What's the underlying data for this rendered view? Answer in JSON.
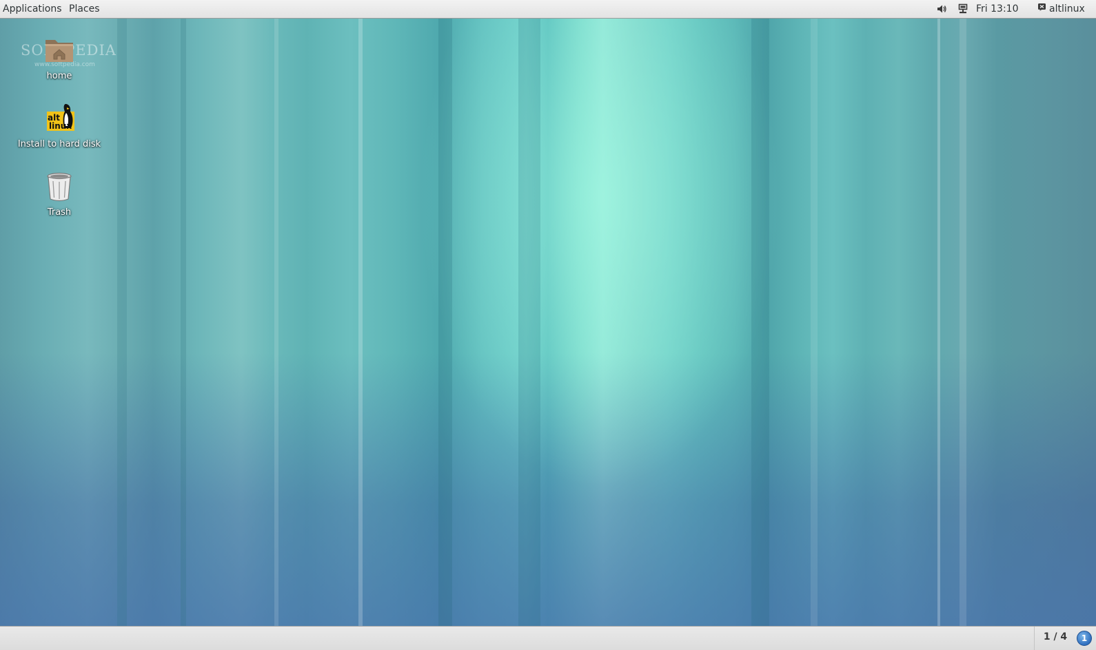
{
  "top_panel": {
    "applications_label": "Applications",
    "places_label": "Places",
    "clock": "Fri 13:10",
    "user_name": "altlinux",
    "icons": {
      "volume": "speaker-volume-icon",
      "network": "wired-network-icon",
      "user": "user-status-icon"
    }
  },
  "desktop": {
    "watermark": "SOFTPEDIA",
    "watermark_url": "www.softpedia.com",
    "icons": [
      {
        "label": "home",
        "icon": "home-folder-icon"
      },
      {
        "label": "Install to hard disk",
        "icon": "altlinux-installer-icon"
      },
      {
        "label": "Trash",
        "icon": "trash-icon"
      }
    ]
  },
  "bottom_panel": {
    "workspace": "1 / 4",
    "notification_count": "1"
  },
  "colors": {
    "panel_bg": "#e6e6e6",
    "wallpaper_teal": "#6ccdc9",
    "wallpaper_blue": "#5a86b3",
    "badge_blue": "#2f6fbf"
  }
}
